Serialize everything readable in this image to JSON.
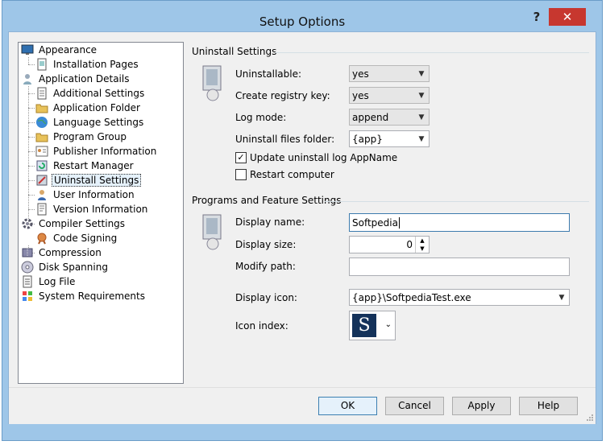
{
  "window": {
    "title": "Setup Options",
    "help_label": "?",
    "close_label": "✕"
  },
  "tree": [
    {
      "label": "Appearance",
      "icon": "monitor-icon"
    },
    {
      "label": "Installation Pages",
      "icon": "page-icon"
    },
    {
      "label": "Application Details",
      "icon": "user-icon"
    },
    {
      "label": "Additional Settings",
      "icon": "settings-page-icon"
    },
    {
      "label": "Application Folder",
      "icon": "folder-icon"
    },
    {
      "label": "Language Settings",
      "icon": "globe-icon"
    },
    {
      "label": "Program Group",
      "icon": "folder-icon"
    },
    {
      "label": "Publisher Information",
      "icon": "publisher-icon"
    },
    {
      "label": "Restart Manager",
      "icon": "restart-icon"
    },
    {
      "label": "Uninstall Settings",
      "icon": "uninstall-icon",
      "selected": true
    },
    {
      "label": "User Information",
      "icon": "user-icon"
    },
    {
      "label": "Version Information",
      "icon": "version-icon"
    },
    {
      "label": "Compiler Settings",
      "icon": "gear-icon"
    },
    {
      "label": "Code Signing",
      "icon": "certificate-icon"
    },
    {
      "label": "Compression",
      "icon": "compression-icon"
    },
    {
      "label": "Disk Spanning",
      "icon": "disk-icon"
    },
    {
      "label": "Log File",
      "icon": "log-icon"
    },
    {
      "label": "System Requirements",
      "icon": "windows-logo-icon"
    }
  ],
  "uninstall": {
    "group_title": "Uninstall Settings",
    "uninstallable_label": "Uninstallable:",
    "uninstallable_value": "yes",
    "registry_label": "Create registry key:",
    "registry_value": "yes",
    "logmode_label": "Log mode:",
    "logmode_value": "append",
    "folder_label": "Uninstall files folder:",
    "folder_value": "{app}",
    "update_log_label": "Update uninstall log AppName",
    "update_log_checked": true,
    "restart_label": "Restart computer",
    "restart_checked": false
  },
  "programs": {
    "group_title": "Programs and Feature Settings",
    "display_name_label": "Display name:",
    "display_name_value": "Softpedia",
    "display_size_label": "Display size:",
    "display_size_value": "0",
    "modify_path_label": "Modify path:",
    "modify_path_value": "",
    "display_icon_label": "Display icon:",
    "display_icon_value": "{app}\\SoftpediaTest.exe",
    "icon_index_label": "Icon index:",
    "icon_index_glyph": "S"
  },
  "buttons": {
    "ok": "OK",
    "cancel": "Cancel",
    "apply": "Apply",
    "help": "Help"
  },
  "colors": {
    "accent": "#3c7fb1",
    "close_red": "#c7372f",
    "icon_navy": "#14325a"
  }
}
